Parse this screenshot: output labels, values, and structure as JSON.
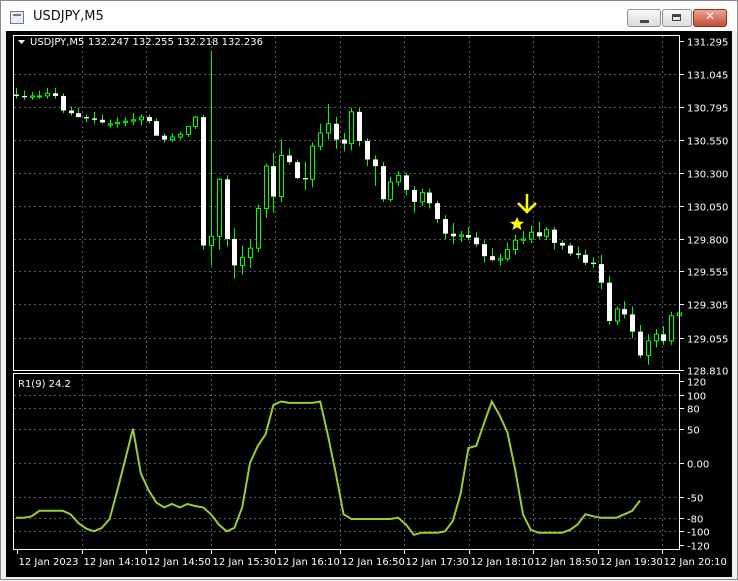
{
  "window": {
    "title": "USDJPY,M5",
    "close_glyph": "✕"
  },
  "chart_header": {
    "symbol_period": "USDJPY,M5",
    "ohlc": "132.247 132.255 132.218 132.236"
  },
  "indicator": {
    "label": "R1(9) 24.2"
  },
  "price_axis": {
    "labels": [
      "131.295",
      "131.045",
      "130.795",
      "130.550",
      "130.300",
      "130.050",
      "129.800",
      "129.555",
      "129.305",
      "129.055",
      "128.810"
    ]
  },
  "indicator_axis": {
    "labels": [
      "120",
      "100",
      "80",
      "50",
      "0.00",
      "-50",
      "-80",
      "-100",
      "-120"
    ]
  },
  "time_axis": {
    "labels": [
      "12 Jan 2023",
      "12 Jan 14:10",
      "12 Jan 14:50",
      "12 Jan 15:30",
      "12 Jan 16:10",
      "12 Jan 16:50",
      "12 Jan 17:30",
      "12 Jan 18:10",
      "12 Jan 18:50",
      "12 Jan 19:30",
      "12 Jan 20:10"
    ]
  },
  "colors": {
    "background": "#000000",
    "grid": "#5a5a5a",
    "candle": "#00ff00",
    "indicator_line": "#9acd32",
    "axis_text": "#ffffff",
    "signal": "#ffff00"
  },
  "signals": {
    "arrow": "down-arrow-icon",
    "star": "star-icon"
  },
  "chart_data": [
    {
      "type": "candlestick",
      "x": [
        0,
        1,
        2,
        3,
        4,
        5,
        6,
        7,
        8,
        9,
        10,
        11,
        12,
        13,
        14,
        15,
        16,
        17,
        18,
        19,
        20,
        21,
        22,
        23,
        24,
        25,
        26,
        27,
        28,
        29,
        30,
        31,
        32,
        33,
        34,
        35,
        36,
        37,
        38,
        39,
        40,
        41,
        42,
        43,
        44,
        45,
        46,
        47,
        48,
        49,
        50,
        51,
        52,
        53,
        54,
        55,
        56,
        57,
        58,
        59,
        60,
        61,
        62,
        63,
        64,
        65,
        66,
        67,
        68,
        69,
        70,
        71,
        72,
        73,
        74,
        75,
        76,
        77,
        78,
        79,
        80,
        81,
        82,
        83,
        84,
        85
      ],
      "open": [
        130.89,
        130.88,
        130.87,
        130.88,
        130.88,
        130.9,
        130.88,
        130.77,
        130.75,
        130.72,
        130.71,
        130.7,
        130.66,
        130.67,
        130.68,
        130.69,
        130.7,
        130.72,
        130.69,
        130.58,
        130.55,
        130.57,
        130.59,
        130.65,
        130.72,
        129.75,
        129.82,
        130.25,
        129.8,
        129.6,
        129.66,
        129.73,
        130.03,
        130.35,
        130.12,
        130.43,
        130.38,
        130.26,
        130.25,
        130.5,
        130.6,
        130.67,
        130.55,
        130.52,
        130.76,
        130.54,
        130.4,
        130.35,
        130.1,
        130.23,
        130.28,
        130.17,
        130.08,
        130.15,
        130.07,
        129.95,
        129.84,
        129.82,
        129.83,
        129.81,
        129.76,
        129.67,
        129.64,
        129.65,
        129.72,
        129.79,
        129.8,
        129.85,
        129.82,
        129.87,
        129.77,
        129.75,
        129.69,
        129.68,
        129.62,
        129.61,
        129.47,
        129.18,
        129.27,
        129.23,
        129.1,
        128.92,
        129.03,
        129.08,
        129.03,
        129.22
      ],
      "high": [
        130.94,
        130.92,
        130.91,
        130.92,
        130.94,
        130.94,
        130.9,
        130.8,
        130.79,
        130.74,
        130.76,
        130.74,
        130.7,
        130.72,
        130.72,
        130.75,
        130.74,
        130.74,
        130.71,
        130.6,
        130.6,
        130.61,
        130.65,
        130.73,
        130.74,
        131.22,
        130.26,
        130.28,
        129.88,
        129.75,
        129.8,
        130.06,
        130.37,
        130.45,
        130.55,
        130.48,
        130.4,
        130.38,
        130.53,
        130.67,
        130.82,
        130.72,
        130.6,
        130.79,
        130.79,
        130.56,
        130.43,
        130.38,
        130.27,
        130.31,
        130.3,
        130.2,
        130.18,
        130.18,
        130.09,
        129.98,
        129.92,
        129.86,
        129.89,
        129.85,
        129.79,
        129.73,
        129.69,
        129.77,
        129.83,
        129.86,
        129.9,
        129.93,
        129.89,
        129.89,
        129.79,
        129.77,
        129.74,
        129.72,
        129.66,
        129.68,
        129.52,
        129.29,
        129.33,
        129.29,
        129.15,
        129.08,
        129.12,
        129.14,
        129.25,
        129.29
      ],
      "low": [
        130.86,
        130.85,
        130.85,
        130.86,
        130.86,
        130.86,
        130.75,
        130.73,
        130.72,
        130.68,
        130.67,
        130.67,
        130.64,
        130.64,
        130.65,
        130.66,
        130.66,
        130.67,
        130.58,
        130.53,
        130.53,
        130.55,
        130.57,
        130.63,
        129.72,
        129.6,
        129.72,
        129.74,
        129.5,
        129.53,
        129.58,
        129.7,
        129.96,
        130.0,
        130.08,
        130.36,
        130.25,
        130.17,
        130.19,
        130.47,
        130.55,
        130.48,
        130.46,
        130.47,
        130.5,
        130.35,
        130.2,
        130.08,
        130.08,
        130.2,
        130.13,
        130.0,
        130.05,
        130.03,
        129.92,
        129.8,
        129.76,
        129.78,
        129.79,
        129.74,
        129.62,
        129.63,
        129.6,
        129.63,
        129.68,
        129.76,
        129.77,
        129.8,
        129.79,
        129.72,
        129.72,
        129.67,
        129.65,
        129.6,
        129.58,
        129.42,
        129.15,
        129.15,
        129.2,
        129.05,
        128.9,
        128.85,
        128.98,
        129.0,
        129.0,
        129.13
      ],
      "close": [
        130.88,
        130.87,
        130.88,
        130.88,
        130.9,
        130.88,
        130.77,
        130.75,
        130.72,
        130.71,
        130.7,
        130.68,
        130.67,
        130.68,
        130.69,
        130.7,
        130.72,
        130.69,
        130.58,
        130.55,
        130.57,
        130.59,
        130.65,
        130.72,
        129.75,
        129.82,
        130.25,
        129.8,
        129.6,
        129.66,
        129.73,
        130.03,
        130.35,
        130.12,
        130.43,
        130.38,
        130.26,
        130.25,
        130.5,
        130.6,
        130.67,
        130.55,
        130.52,
        130.76,
        130.54,
        130.4,
        130.35,
        130.1,
        130.23,
        130.28,
        130.17,
        130.08,
        130.15,
        130.07,
        129.95,
        129.84,
        129.82,
        129.83,
        129.81,
        129.76,
        129.67,
        129.64,
        129.65,
        129.72,
        129.79,
        129.8,
        129.85,
        129.82,
        129.87,
        129.77,
        129.75,
        129.69,
        129.68,
        129.62,
        129.61,
        129.47,
        129.18,
        129.27,
        129.23,
        129.1,
        128.92,
        129.03,
        129.08,
        129.03,
        129.22,
        129.24
      ],
      "ylim": [
        128.81,
        131.295
      ],
      "grid": true
    },
    {
      "type": "line",
      "x": [
        0,
        1,
        2,
        3,
        4,
        5,
        6,
        7,
        8,
        9,
        10,
        11,
        12,
        13,
        14,
        15,
        16,
        17,
        18,
        19,
        20,
        21,
        22,
        23,
        24,
        25,
        26,
        27,
        28,
        29,
        30,
        31,
        32,
        33,
        34,
        35,
        36,
        37,
        38,
        39,
        40,
        41,
        42,
        43,
        44,
        45,
        46,
        47,
        48,
        49,
        50,
        51,
        52,
        53,
        54,
        55,
        56,
        57,
        58,
        59,
        60,
        61,
        62,
        63,
        64,
        65,
        66,
        67,
        68,
        69,
        70,
        71,
        72,
        73,
        74,
        75,
        76,
        77,
        78,
        79,
        80,
        81,
        82,
        83,
        84,
        85
      ],
      "values": [
        -80,
        -80,
        -78,
        -70,
        -70,
        -70,
        -70,
        -75,
        -88,
        -96,
        -100,
        -95,
        -82,
        -40,
        5,
        50,
        -15,
        -40,
        -58,
        -65,
        -60,
        -65,
        -60,
        -63,
        -65,
        -75,
        -90,
        -100,
        -95,
        -65,
        0,
        25,
        42,
        85,
        90,
        88,
        88,
        88,
        88,
        90,
        40,
        -15,
        -75,
        -82,
        -82,
        -82,
        -82,
        -82,
        -82,
        -80,
        -90,
        -105,
        -102,
        -102,
        -102,
        -100,
        -85,
        -45,
        22,
        25,
        58,
        90,
        70,
        45,
        -10,
        -75,
        -98,
        -102,
        -102,
        -102,
        -102,
        -98,
        -90,
        -75,
        -78,
        -80,
        -80,
        -80,
        -75,
        -70,
        -55
      ],
      "label": "R1(9) 24.2",
      "ylim": [
        -120,
        120
      ],
      "grid": true
    }
  ]
}
